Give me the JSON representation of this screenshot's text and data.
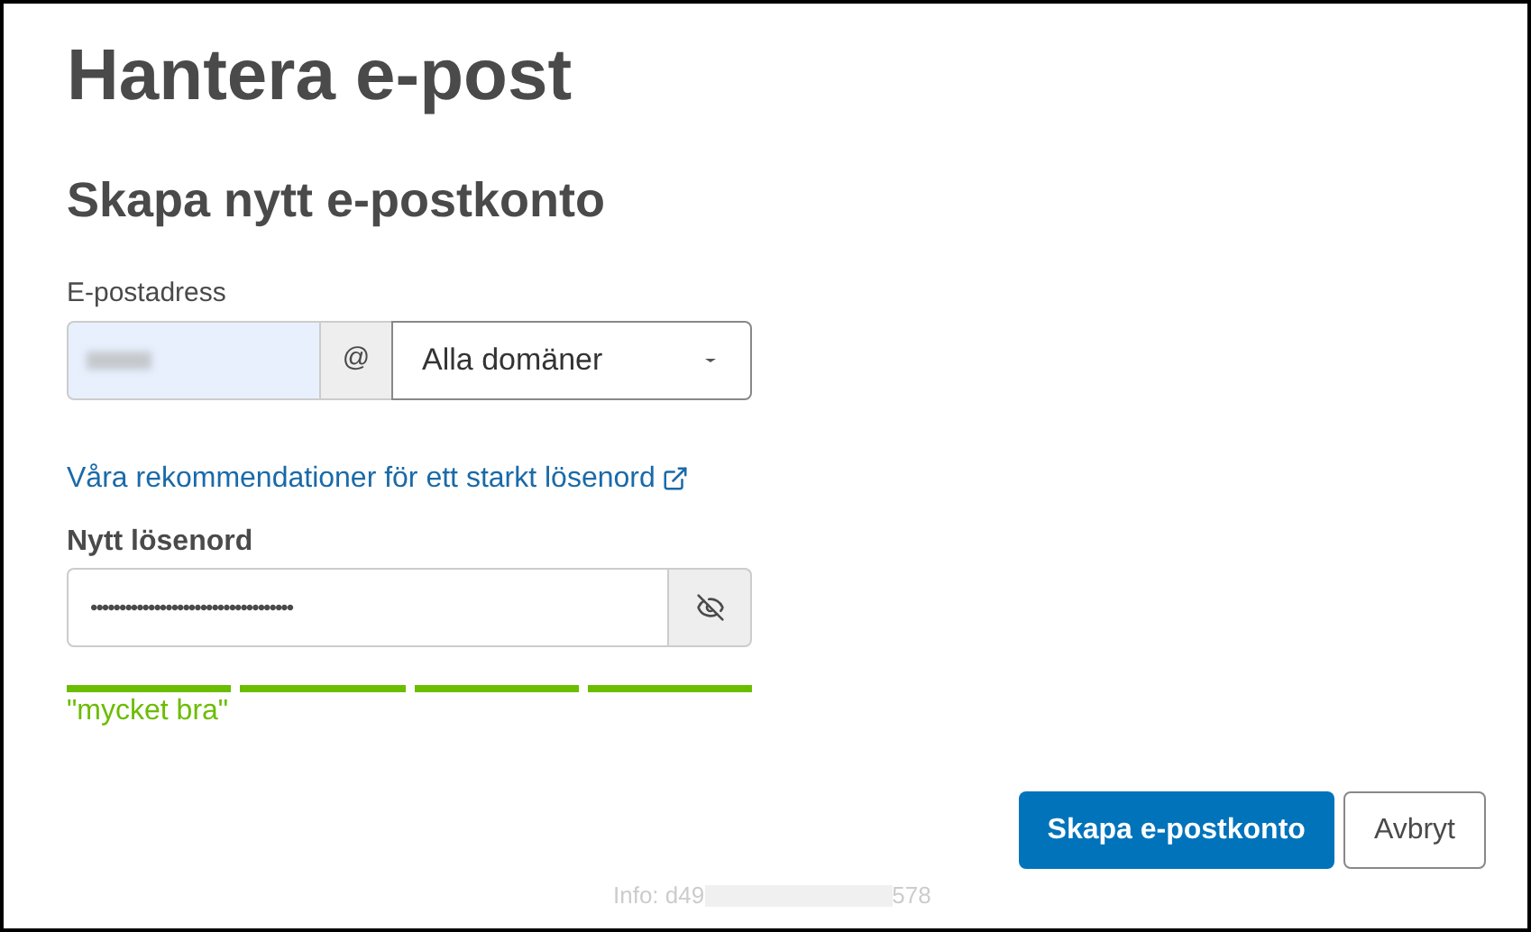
{
  "title": "Hantera e-post",
  "subtitle": "Skapa nytt e-postkonto",
  "email": {
    "label": "E-postadress",
    "at": "@",
    "domain": "Alla domäner"
  },
  "link": "Våra rekommendationer för ett starkt lösenord",
  "password": {
    "label": "Nytt lösenord",
    "value": "•••••••••••••••••••••••••••••••••••"
  },
  "strength": {
    "segments": [
      {
        "on": true
      },
      {
        "on": true
      },
      {
        "on": true
      },
      {
        "on": true
      }
    ],
    "label": "\"mycket bra\""
  },
  "buttons": [
    {
      "label": "Skapa e-postkonto",
      "kind": "primary"
    },
    {
      "label": "Avbryt",
      "kind": "secondary"
    }
  ],
  "info": {
    "start": "Info: d49",
    "end": "578"
  }
}
